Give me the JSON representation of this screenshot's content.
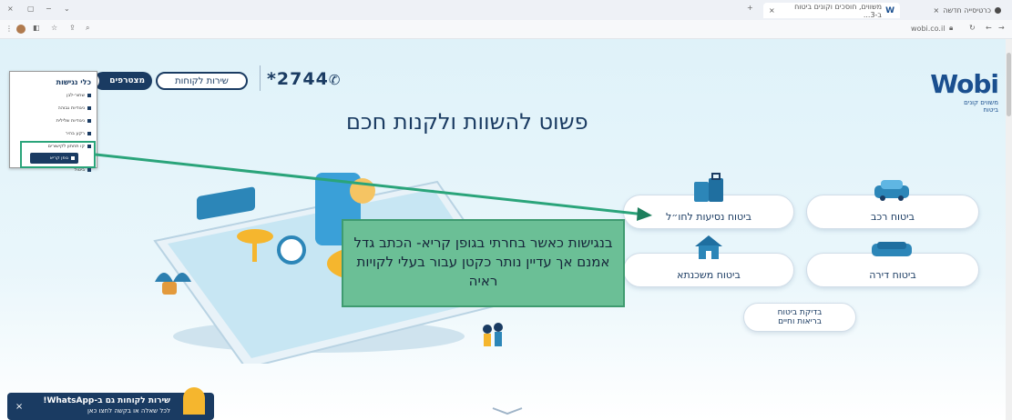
{
  "browser": {
    "tabs": [
      {
        "title": "משווים, חוסכים וקונים ביטוח ב-3...",
        "close": "×"
      },
      {
        "title": "כרטיסייה חדשה",
        "close": "×"
      }
    ],
    "new_tab": "+",
    "address": "wobi.co.il"
  },
  "header": {
    "logo_word": "Wobi",
    "logo_sub_1": "משווים קונים",
    "logo_sub_2": "ביטוח",
    "phone": "*2744",
    "customer_service": "שירות לקוחות",
    "join": "מצטרפים"
  },
  "accessibility_panel": {
    "title": "כלי נגישות",
    "items": [
      "שחור-לבן",
      "ניגודיות גבוהה",
      "ניגודיות שלילית",
      "רקע בהיר",
      "קו תחתון לקישורים",
      "גופן קריא",
      "ביטול"
    ]
  },
  "hero": {
    "headline": "פשוט להשוות ולקנות חכם"
  },
  "insurance": {
    "car": "ביטוח רכב",
    "travel": "ביטוח נסיעות לחו״ל",
    "apartment": "ביטוח דירה",
    "mortgage": "ביטוח משכנתא",
    "health_line1": "בדיקת ביטוח",
    "health_line2": "בריאות וחיים"
  },
  "callout": {
    "text": "בנגישות כאשר בחרתי בגופן קריא- הכתב גדל אמנם אך עדיין נותר כקטן עבור בעלי לקויות ראיה"
  },
  "whatsapp": {
    "title": "שירות לקוחות גם ב-WhatsApp!",
    "subtitle": "לכל שאלה או בקשה לחצו כאן",
    "close": "×"
  },
  "colors": {
    "brand": "#1a3b62",
    "callout": "#6bbf96",
    "arrow": "#2aa47a"
  }
}
